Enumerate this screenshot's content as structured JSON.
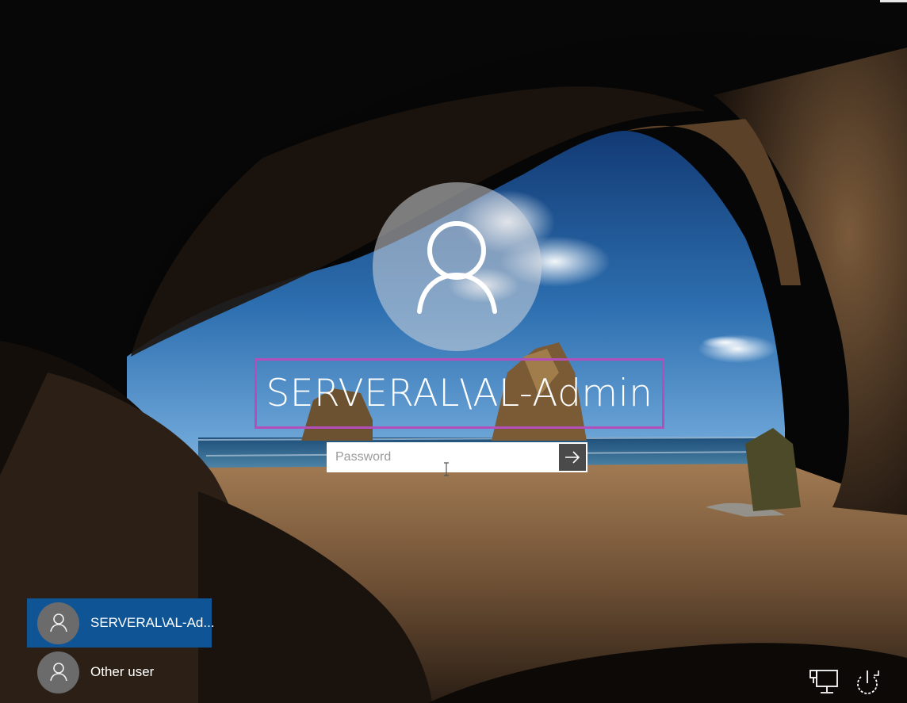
{
  "login": {
    "username": "SERVERAL\\AL-Admin",
    "password_placeholder": "Password",
    "password_value": "",
    "submit_icon": "arrow-right-icon"
  },
  "user_list": [
    {
      "label": "SERVERAL\\AL-Ad...",
      "selected": true,
      "icon": "user-icon"
    },
    {
      "label": "Other user",
      "selected": false,
      "icon": "user-icon"
    }
  ],
  "system_icons": [
    "network-icon",
    "power-icon"
  ],
  "colors": {
    "highlight_box": "#b24fbb",
    "selected_tile": "#0f5596",
    "avatar_bg": "#6b6b6b",
    "submit_button": "#4a4a4a"
  }
}
